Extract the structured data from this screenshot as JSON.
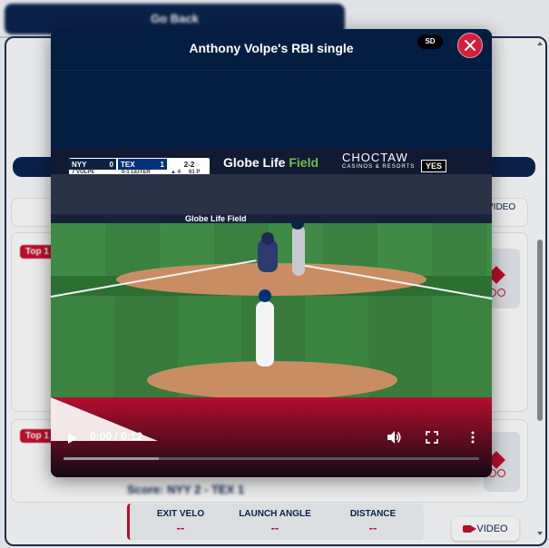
{
  "background": {
    "go_back_label": "Go Back",
    "video_partial_label": "VIDEO",
    "video_button_label": "VIDEO",
    "score_text": "Score: NYY 2 - TEX 1",
    "tag_label": "Top 1",
    "stats": [
      {
        "label": "EXIT VELO",
        "value": "--"
      },
      {
        "label": "LAUNCH ANGLE",
        "value": "--"
      },
      {
        "label": "DISTANCE",
        "value": "--"
      }
    ]
  },
  "modal": {
    "title": "Anthony Volpe's RBI single",
    "quality_badge": "SD",
    "close_icon": "close-icon"
  },
  "video_frame": {
    "ads": {
      "globe_a": "Globe Life ",
      "globe_b": "Field",
      "choctaw": "CHOCTAW",
      "choctaw_sub": "CASINOS & RESORTS",
      "yes": "YES"
    },
    "stands_sign": "Globe Life Field",
    "scorebug": {
      "away_team": "NYY",
      "away_score": "0",
      "home_team": "TEX",
      "home_score": "1",
      "count": "2-2",
      "outs": "▲ 4",
      "away_sub": "7 VOLPE",
      "home_sub": "0-1  LEITER",
      "pitch_sub": "61 P"
    }
  },
  "player_controls": {
    "time_display": "0:00 / 0:12",
    "buffered_fraction": 0.23
  },
  "colors": {
    "navy": "#041e42",
    "red": "#d31f3b"
  }
}
